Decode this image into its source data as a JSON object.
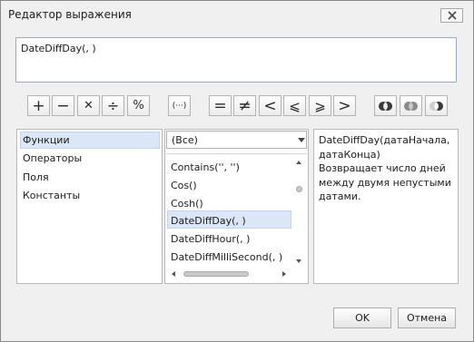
{
  "window": {
    "title": "Редактор выражения"
  },
  "expression": {
    "value": "DateDiffDay(, )"
  },
  "toolbar": {
    "buttons": [
      {
        "name": "plus-button",
        "glyph": "+"
      },
      {
        "name": "minus-button",
        "glyph": "−"
      },
      {
        "name": "multiply-button",
        "glyph": "✕"
      },
      {
        "name": "divide-button",
        "glyph": "÷"
      },
      {
        "name": "percent-button",
        "glyph": "%"
      },
      {
        "name": "parentheses-button",
        "glyph": "(···)"
      },
      {
        "name": "equals-button",
        "glyph": "="
      },
      {
        "name": "not-equals-button",
        "glyph": "≠"
      },
      {
        "name": "less-than-button",
        "glyph": "<"
      },
      {
        "name": "less-or-equal-button",
        "glyph": "⩽"
      },
      {
        "name": "greater-or-equal-button",
        "glyph": "⩾"
      },
      {
        "name": "greater-than-button",
        "glyph": ">"
      }
    ]
  },
  "categories": {
    "items": [
      "Функции",
      "Операторы",
      "Поля",
      "Константы"
    ],
    "selected_index": 0
  },
  "functions": {
    "filter_value": "(Все)",
    "items": [
      "Contains('', '')",
      "Cos()",
      "Cosh()",
      "DateDiffDay(, )",
      "DateDiffHour(, )",
      "DateDiffMilliSecond(, )"
    ],
    "selected_index": 3
  },
  "description": {
    "text": "DateDiffDay(датаНачала, датаКонца)\nВозвращает число дней между двумя непустыми датами."
  },
  "footer": {
    "ok_label": "OK",
    "cancel_label": "Отмена"
  },
  "colors": {
    "selection": "#dbe6f7",
    "border": "#9aa9c0"
  }
}
